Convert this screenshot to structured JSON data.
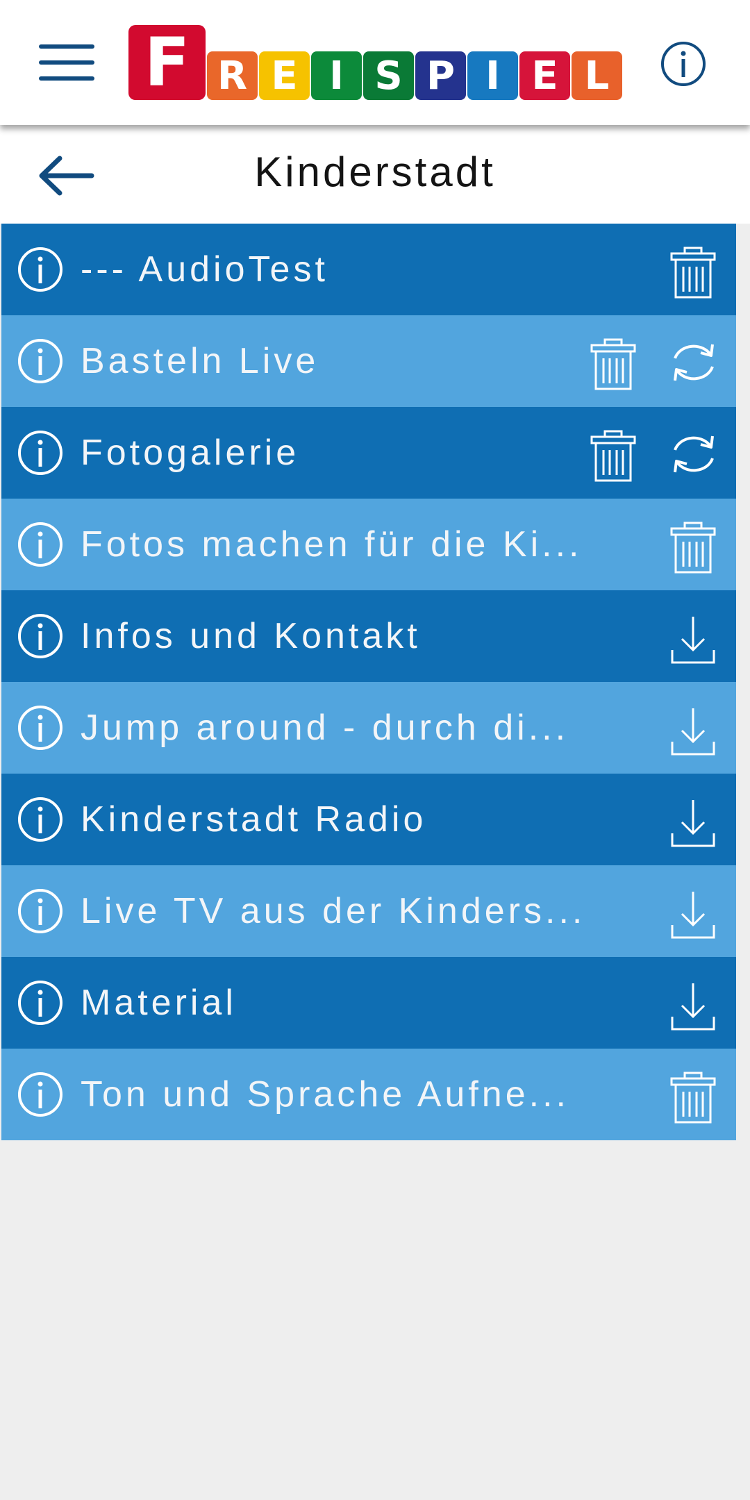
{
  "app": {
    "brand_letters": [
      "F",
      "R",
      "E",
      "I",
      "S",
      "P",
      "I",
      "E",
      "L"
    ],
    "brand_colors": [
      "#d20a2f",
      "#e9672a",
      "#f6c200",
      "#0c8a3a",
      "#0a7a36",
      "#24338e",
      "#1779c0",
      "#d6143a",
      "#e8612b"
    ]
  },
  "header": {
    "menu_icon": "hamburger-icon",
    "info_icon": "info-icon"
  },
  "subheader": {
    "title": "Kinderstadt",
    "back_icon": "arrow-left-icon"
  },
  "list": {
    "items": [
      {
        "label": "--- AudioTest",
        "actions": [
          "trash-icon"
        ]
      },
      {
        "label": "Basteln Live",
        "actions": [
          "trash-icon",
          "refresh-icon"
        ]
      },
      {
        "label": "Fotogalerie",
        "actions": [
          "trash-icon",
          "refresh-icon"
        ]
      },
      {
        "label": "Fotos machen für die Ki...",
        "actions": [
          "trash-icon"
        ]
      },
      {
        "label": "Infos und Kontakt",
        "actions": [
          "download-icon"
        ]
      },
      {
        "label": "Jump around - durch di...",
        "actions": [
          "download-icon"
        ]
      },
      {
        "label": "Kinderstadt Radio",
        "actions": [
          "download-icon"
        ]
      },
      {
        "label": "Live TV aus der Kinders...",
        "actions": [
          "download-icon"
        ]
      },
      {
        "label": "Material",
        "actions": [
          "download-icon"
        ]
      },
      {
        "label": "Ton und Sprache Aufne...",
        "actions": [
          "trash-icon"
        ]
      }
    ]
  },
  "colors": {
    "row_dark": "#0f6eb3",
    "row_light": "#52a5de",
    "accent": "#114b7f",
    "background": "#eeeeee"
  }
}
